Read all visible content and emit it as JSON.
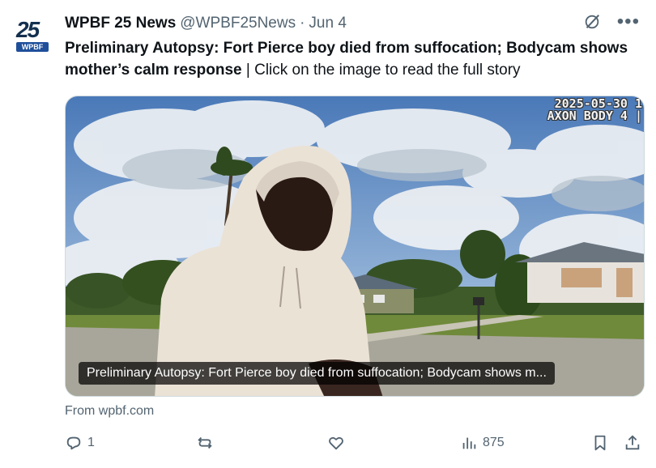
{
  "account": {
    "avatar_number": "25",
    "avatar_tag": "WPBF",
    "name": "WPBF 25 News",
    "handle": "@WPBF25News",
    "separator": "·",
    "date": "Jun 4"
  },
  "tweet": {
    "headline": "Preliminary Autopsy: Fort Pierce boy died from suffocation; Bodycam shows mother’s calm response",
    "divider": " | ",
    "tail": "Click on the image to read the full story"
  },
  "media": {
    "caption": "Preliminary Autopsy: Fort Pierce boy died from suffocation; Bodycam shows m...",
    "stamp_line1": "2025-05-30 1",
    "stamp_line2": "AXON BODY 4 |"
  },
  "link": {
    "source": "From wpbf.com"
  },
  "actions": {
    "replies": "1",
    "reposts": "",
    "likes": "",
    "views": "875"
  },
  "icons": [
    "grok-icon",
    "more-icon",
    "reply-icon",
    "repost-icon",
    "like-icon",
    "views-icon",
    "bookmark-icon",
    "share-icon"
  ]
}
